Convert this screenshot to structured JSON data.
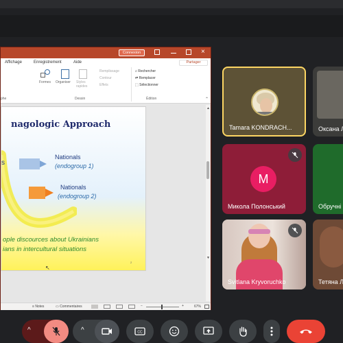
{
  "ppt": {
    "title_button": "Connexion",
    "share_label": "Partager",
    "menus": [
      "Affichage",
      "Enregistrement",
      "Aide"
    ],
    "ribbon": {
      "formes": "Formes",
      "organiser": "Organiser",
      "styles": "Styles rapides",
      "remplissage": "Remplissage",
      "contour": "Contour",
      "effets": "Effets",
      "rechercher": "Rechercher",
      "remplacer": "Remplacer",
      "selectionner": "Sélectionner",
      "group_dessin": "Dessin",
      "group_edition": "Édition",
      "group_left": "phe"
    },
    "slide": {
      "title": "nagologic Approach",
      "left_fragment": "s",
      "nationals1": "Nationals",
      "endogroup1": "(endogroup 1)",
      "nationals2": "Nationals",
      "endogroup2": "(endogroup 2)",
      "footer_line1": "ople discources about Ukrainians",
      "footer_line2": "ians in intercultural situations",
      "page_mark": "2"
    },
    "status": {
      "notes": "Notes",
      "comments": "Commentaires",
      "zoom": "67%"
    }
  },
  "participants": [
    {
      "name": "Tamara KONDRACH...",
      "avatar_letter": "",
      "muted": false,
      "active": true
    },
    {
      "name": "Оксана Л",
      "avatar_letter": "",
      "muted": false,
      "active": false
    },
    {
      "name": "Микола Полонський",
      "avatar_letter": "M",
      "muted": true,
      "active": false
    },
    {
      "name": "Обручні",
      "avatar_letter": "",
      "muted": false,
      "active": false
    },
    {
      "name": "Svitlana Kryvoruchko",
      "avatar_letter": "",
      "muted": true,
      "active": false
    },
    {
      "name": "Тетяна Л",
      "avatar_letter": "",
      "muted": false,
      "active": false
    }
  ],
  "colors": {
    "meet_bg": "#202124",
    "ppt_accent": "#b7472a",
    "end_call": "#ea4335",
    "muted_red": "#f28b82",
    "active_border": "#fdd663",
    "avatar_pink": "#e91e63"
  },
  "controls": {
    "icons": [
      "chevron-up-icon",
      "mic-off-icon",
      "chevron-up-icon",
      "camera-icon",
      "captions-icon",
      "emoji-icon",
      "present-icon",
      "raise-hand-icon",
      "more-icon",
      "end-call-icon"
    ]
  }
}
